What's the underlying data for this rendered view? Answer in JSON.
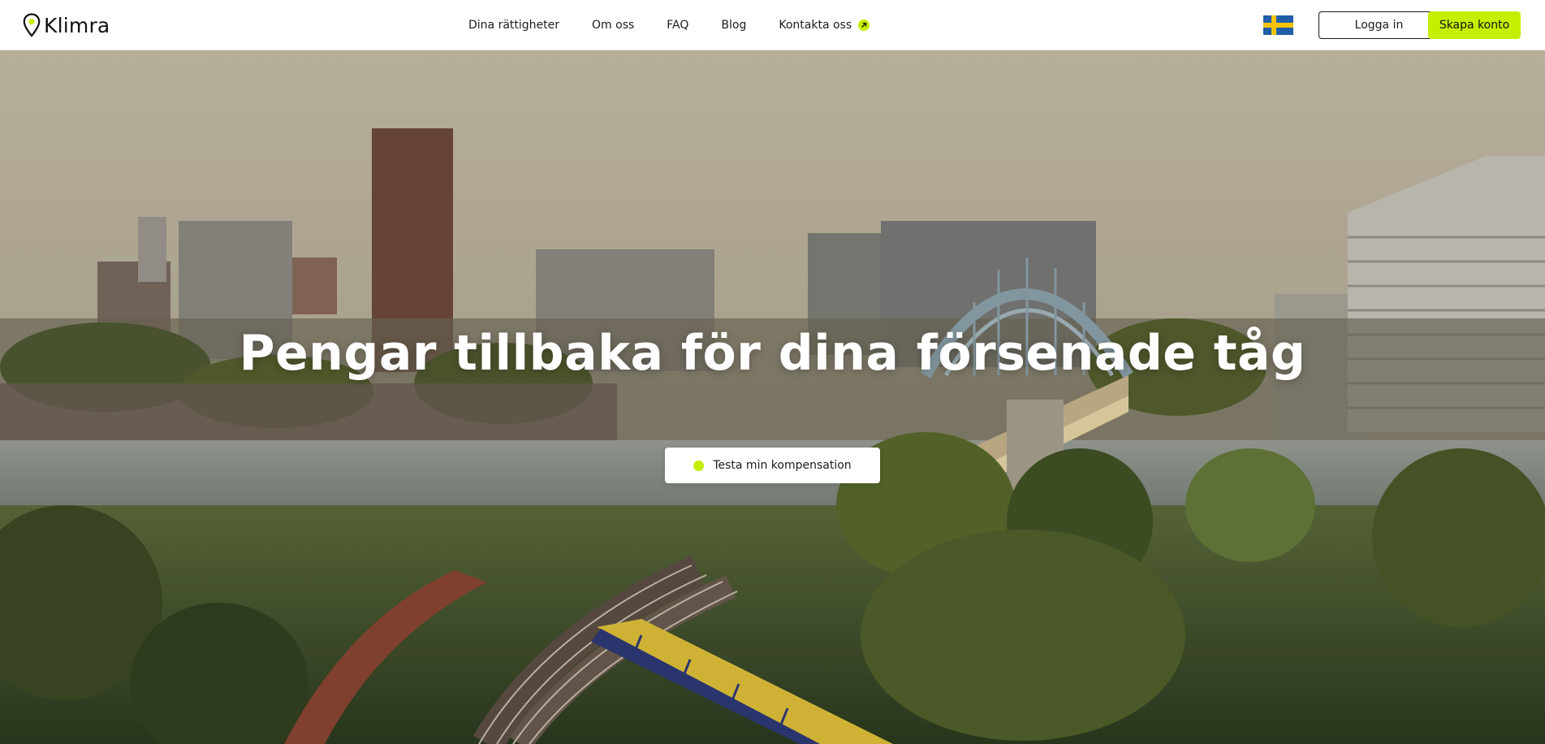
{
  "brand": {
    "name": "Klimra",
    "logo_icon": "map-pin-icon",
    "accent_color": "#c4f000"
  },
  "nav": {
    "links": [
      {
        "label": "Dina rättigheter"
      },
      {
        "label": "Om oss"
      },
      {
        "label": "FAQ"
      },
      {
        "label": "Blog"
      },
      {
        "label": "Kontakta oss",
        "icon": "arrow-up-right-icon"
      }
    ]
  },
  "header_actions": {
    "language_flag": "sweden-flag-icon",
    "login_label": "Logga in",
    "signup_label": "Skapa konto"
  },
  "hero": {
    "title": "Pengar tillbaka för dina försenade tåg",
    "cta_label": "Testa min kompensation",
    "background": "city skyline with railway bridge and yellow train"
  }
}
